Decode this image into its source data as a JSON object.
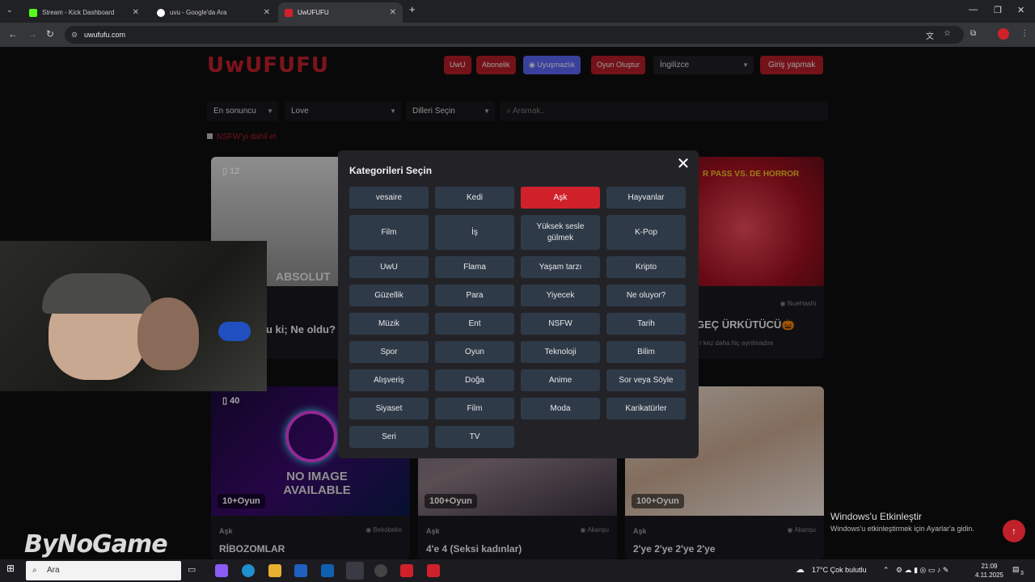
{
  "browser": {
    "tabs": [
      {
        "title": "Stream - Kick Dashboard",
        "favicon_color": "#53fc18"
      },
      {
        "title": "uvu - Google'da Ara",
        "favicon_color": "#ffffff"
      },
      {
        "title": "UwUFUFU",
        "favicon_color": "#d0212b"
      }
    ],
    "new_tab": "+",
    "url": "uwufufu.com",
    "window_controls": {
      "minimize": "—",
      "maximize": "❐",
      "close": "✕"
    }
  },
  "site": {
    "logo": "UwUFUFU",
    "nav": {
      "uwu": "UwU",
      "subscription": "Abonelik",
      "discord": "Uyuşmazlık",
      "create_game": "Oyun Oluştur",
      "language": "İngilizce",
      "login": "Giriş yapmak"
    },
    "filters": {
      "sort": "En sonuncu",
      "category": "Love",
      "languages": "Dilleri Seçin",
      "search_placeholder": "Aramak.."
    },
    "nsfw_label": "NSFW'yi dahil et",
    "accent_color": "#c0202a"
  },
  "cards": [
    {
      "badge": "12",
      "title_fragment": "u ki; Ne oldu?",
      "image_text": "ABSOLUT"
    },
    {
      "author": "NueHashi",
      "title": "GEÇ ÜRKÜTÜCÜ🎃",
      "subtitle": "r kez daha hiç ayrılmadım",
      "image_text": "R PASS VS. DE HORROR"
    },
    {
      "badge": "40",
      "count": "10+Oyun",
      "category": "Aşk",
      "author": "Bekobeko",
      "title": "RİBOZOMLAR",
      "image_text": "NO IMAGE AVAILABLE"
    },
    {
      "count": "100+Oyun",
      "category": "Aşk",
      "author": "Akanşu",
      "title": "4'e 4 (Seksi kadınlar)"
    },
    {
      "count": "100+Oyun",
      "category": "Aşk",
      "author": "Akanşu",
      "title": "2'ye 2'ye 2'ye 2'ye"
    }
  ],
  "modal": {
    "title": "Kategorileri Seçin",
    "close": "✕",
    "selected_color": "#d0212b",
    "categories": [
      "vesaire",
      "Kedi",
      "Aşk",
      "Hayvanlar",
      "Film",
      "İş",
      "Yüksek sesle gülmek",
      "K-Pop",
      "UwU",
      "Flama",
      "Yaşam tarzı",
      "Kripto",
      "Güzellik",
      "Para",
      "Yiyecek",
      "Ne oluyor?",
      "Müzik",
      "Ent",
      "NSFW",
      "Tarih",
      "Spor",
      "Oyun",
      "Teknoloji",
      "Bilim",
      "Alışveriş",
      "Doğa",
      "Anime",
      "Sor veya Söyle",
      "Siyaset",
      "Film",
      "Moda",
      "Karikatürler",
      "Seri",
      "TV"
    ],
    "selected": "Aşk"
  },
  "overlay": {
    "watermark": "ByNoGame",
    "activate_title": "Windows'u Etkinleştir",
    "activate_sub": "Windows'u etkinleştirmek için Ayarlar'a gidin."
  },
  "taskbar": {
    "search": "Ara",
    "weather": "17°C  Çok bulutlu",
    "time": "21:09",
    "date": "4.11.2025",
    "notifications": "3"
  }
}
